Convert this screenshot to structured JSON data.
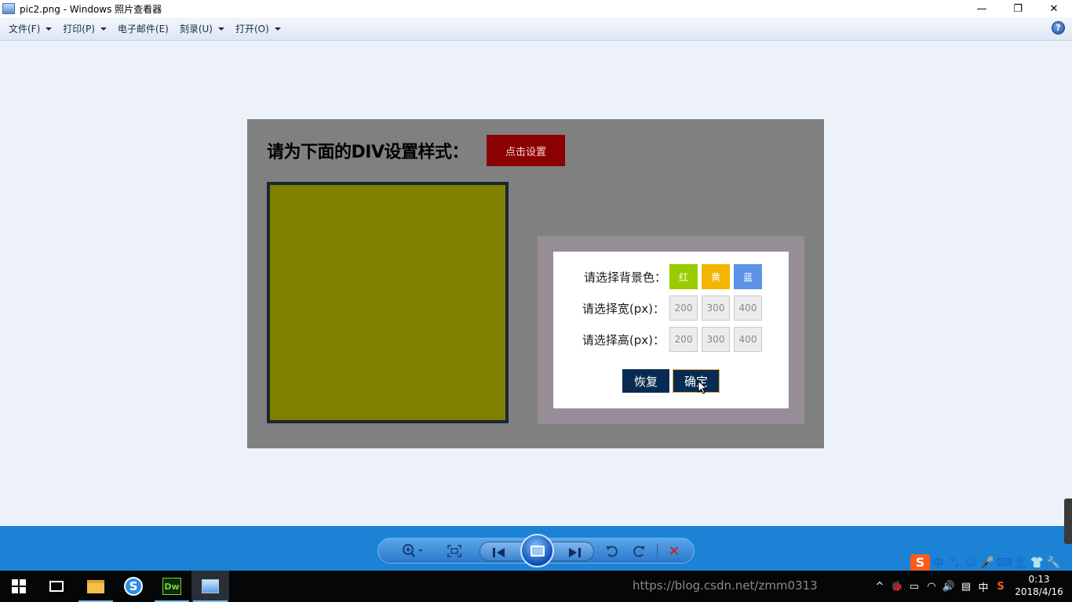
{
  "window": {
    "title": "pic2.png - Windows 照片查看器",
    "minimize": "—",
    "restore": "❐",
    "close": "✕"
  },
  "menu": {
    "items": [
      {
        "label": "文件(F)",
        "has_dropdown": true
      },
      {
        "label": "打印(P)",
        "has_dropdown": true
      },
      {
        "label": "电子邮件(E)",
        "has_dropdown": false
      },
      {
        "label": "刻录(U)",
        "has_dropdown": true
      },
      {
        "label": "打开(O)",
        "has_dropdown": true
      }
    ],
    "help": "?"
  },
  "image": {
    "heading": "请为下面的DIV设置样式：",
    "set_button": "点击设置",
    "div_color": "#808000",
    "panel": {
      "bg_label": "请选择背景色：",
      "bg_options": [
        {
          "label": "红",
          "color": "#99cc00"
        },
        {
          "label": "黄",
          "color": "#f2b600"
        },
        {
          "label": "蓝",
          "color": "#5d93e6"
        }
      ],
      "width_label": "请选择宽(px)：",
      "width_options": [
        "200",
        "300",
        "400"
      ],
      "height_label": "请选择高(px)：",
      "height_options": [
        "200",
        "300",
        "400"
      ],
      "reset": "恢复",
      "confirm": "确定"
    }
  },
  "viewer_toolbar": {
    "zoom": "⊕",
    "fit": "⛶",
    "prev": "⏮",
    "next": "⏭",
    "rotate_ccw": "↺",
    "rotate_cw": "↻",
    "delete": "✕"
  },
  "ime": {
    "logo": "S",
    "items": [
      "中",
      "°,",
      "☺",
      "🎤",
      "⌨",
      "👤",
      "👕",
      "🔧"
    ]
  },
  "taskbar": {
    "dw_label": "Dw",
    "sogou_label": "S"
  },
  "tray": {
    "watermark": "https://blog.csdn.net/zmm0313",
    "icons": [
      "^",
      "🐞",
      "▭",
      "◠",
      "🔊",
      "▤",
      "中",
      "S"
    ],
    "time": "0:13",
    "date": "2018/4/16"
  }
}
